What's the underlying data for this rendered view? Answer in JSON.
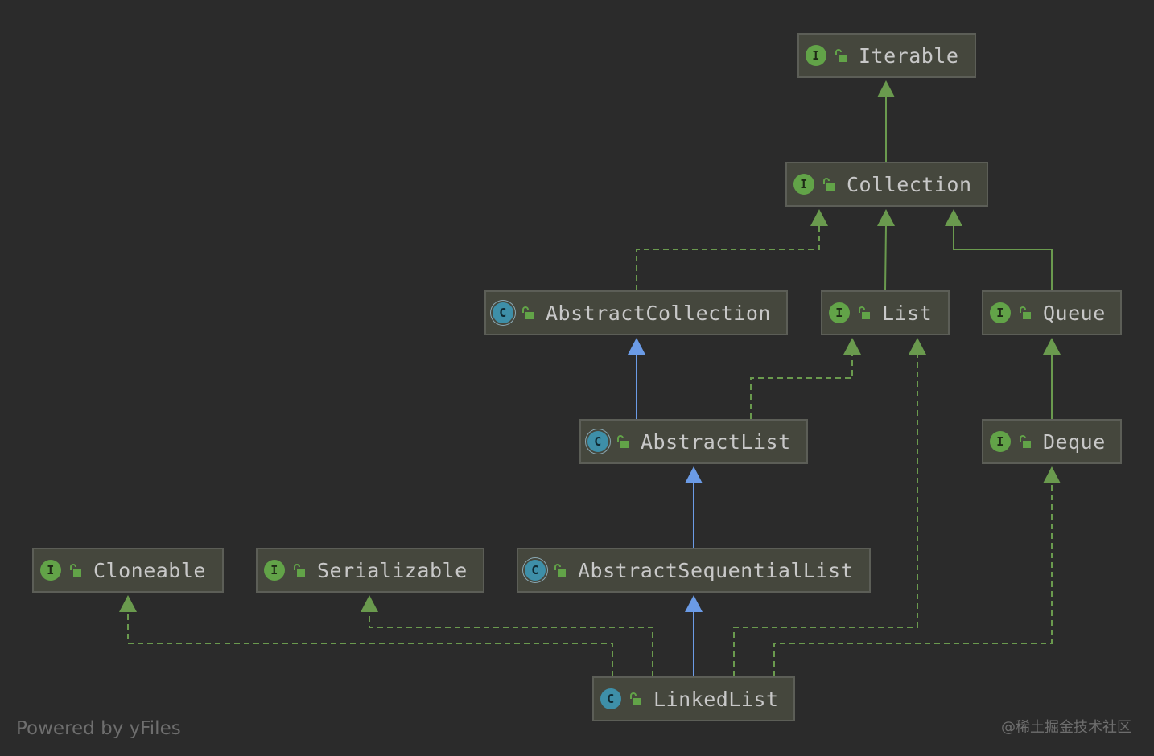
{
  "colors": {
    "background": "#2b2b2b",
    "node_fill": "#45473d",
    "node_border": "#5c5e57",
    "edge_interface": "#6a9a4e",
    "edge_extends": "#6b9be6",
    "icon_interface": "#62a348",
    "icon_class": "#3e8fa8"
  },
  "nodes": [
    {
      "id": "iterable",
      "label": "Iterable",
      "kind": "interface",
      "icon": "I"
    },
    {
      "id": "collection",
      "label": "Collection",
      "kind": "interface",
      "icon": "I"
    },
    {
      "id": "abstractcollection",
      "label": "AbstractCollection",
      "kind": "abstract-class",
      "icon": "C"
    },
    {
      "id": "list",
      "label": "List",
      "kind": "interface",
      "icon": "I"
    },
    {
      "id": "queue",
      "label": "Queue",
      "kind": "interface",
      "icon": "I"
    },
    {
      "id": "abstractlist",
      "label": "AbstractList",
      "kind": "abstract-class",
      "icon": "C"
    },
    {
      "id": "deque",
      "label": "Deque",
      "kind": "interface",
      "icon": "I"
    },
    {
      "id": "cloneable",
      "label": "Cloneable",
      "kind": "interface",
      "icon": "I"
    },
    {
      "id": "serializable",
      "label": "Serializable",
      "kind": "interface",
      "icon": "I"
    },
    {
      "id": "abstractsequentiallist",
      "label": "AbstractSequentialList",
      "kind": "abstract-class",
      "icon": "C"
    },
    {
      "id": "linkedlist",
      "label": "LinkedList",
      "kind": "class",
      "icon": "C"
    }
  ],
  "edges": [
    {
      "from": "collection",
      "to": "iterable",
      "type": "extends-interface"
    },
    {
      "from": "abstractcollection",
      "to": "collection",
      "type": "implements"
    },
    {
      "from": "list",
      "to": "collection",
      "type": "extends-interface"
    },
    {
      "from": "queue",
      "to": "collection",
      "type": "extends-interface"
    },
    {
      "from": "abstractlist",
      "to": "abstractcollection",
      "type": "extends-class"
    },
    {
      "from": "abstractlist",
      "to": "list",
      "type": "implements"
    },
    {
      "from": "deque",
      "to": "queue",
      "type": "extends-interface"
    },
    {
      "from": "abstractsequentiallist",
      "to": "abstractlist",
      "type": "extends-class"
    },
    {
      "from": "linkedlist",
      "to": "abstractsequentiallist",
      "type": "extends-class"
    },
    {
      "from": "linkedlist",
      "to": "cloneable",
      "type": "implements"
    },
    {
      "from": "linkedlist",
      "to": "serializable",
      "type": "implements"
    },
    {
      "from": "linkedlist",
      "to": "list",
      "type": "implements"
    },
    {
      "from": "linkedlist",
      "to": "deque",
      "type": "implements"
    }
  ],
  "footer": {
    "powered_by": "Powered by yFiles",
    "watermark": "@稀土掘金技术社区"
  }
}
